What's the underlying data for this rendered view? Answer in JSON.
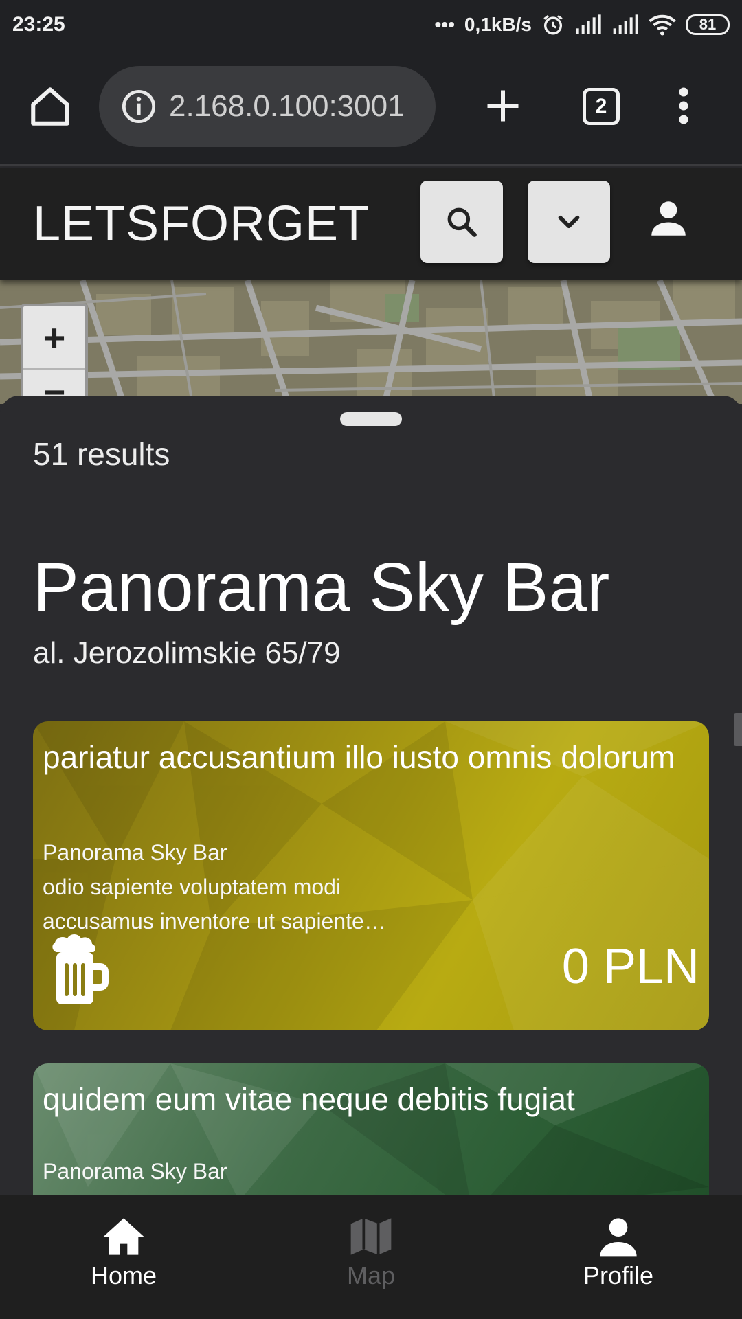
{
  "status_bar": {
    "time": "23:25",
    "network_speed": "0,1kB/s",
    "battery": "81"
  },
  "browser": {
    "url": "2.168.0.100:3001",
    "tab_count": "2"
  },
  "header": {
    "title": "LETSFORGET"
  },
  "map": {
    "zoom_in_label": "+",
    "zoom_out_label": "−"
  },
  "sheet": {
    "results": "51 results",
    "venue_name": "Panorama Sky Bar",
    "venue_address": "al. Jerozolimskie 65/79",
    "cards": [
      {
        "title": "pariatur accusantium illo iusto omnis dolorum",
        "venue": "Panorama Sky Bar",
        "description": "odio sapiente voluptatem modi accusamus inventore ut sapiente…",
        "price": "0 PLN",
        "icon": "beer-mug-icon",
        "color": "#a69a10"
      },
      {
        "title": "quidem eum vitae neque debitis fugiat",
        "venue": "Panorama Sky Bar",
        "color": "#2c5e35"
      }
    ]
  },
  "bottom_nav": {
    "home": "Home",
    "map": "Map",
    "profile": "Profile"
  },
  "colors": {
    "background": "#2b2b2e",
    "header": "#202020",
    "button_bg": "#e4e4e4",
    "inactive_nav": "#5e5e60"
  }
}
